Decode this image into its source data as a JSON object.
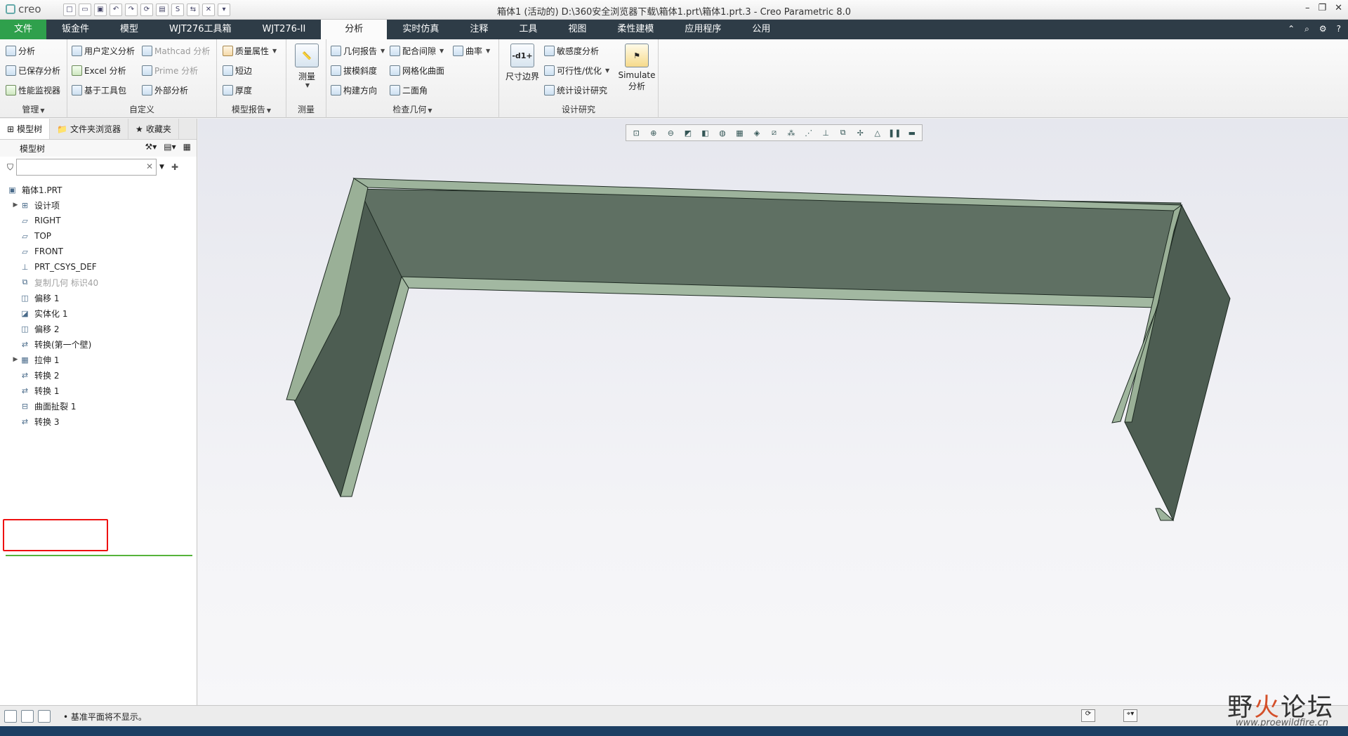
{
  "app": {
    "logo": "creo",
    "window_title": "箱体1 (活动的) D:\\360安全浏览器下载\\箱体1.prt\\箱体1.prt.3 - Creo Parametric 8.0",
    "win_controls": [
      "–",
      "❐",
      "✕"
    ]
  },
  "tabs": [
    "文件",
    "钣金件",
    "模型",
    "WJT276工具箱",
    "WJT276-II",
    "分析",
    "实时仿真",
    "注释",
    "工具",
    "视图",
    "柔性建模",
    "应用程序",
    "公用"
  ],
  "active_tab": "分析",
  "ribbon": {
    "manage": {
      "items": [
        "分析",
        "已保存分析",
        "性能监视器"
      ],
      "label": "管理"
    },
    "custom": {
      "items": [
        "用户定义分析",
        "Mathcad 分析",
        "Excel 分析",
        "Prime 分析",
        "基于工具包",
        "外部分析"
      ],
      "label": "自定义"
    },
    "model_report": {
      "items": [
        "质量属性",
        "短边",
        "厚度"
      ],
      "label": "模型报告"
    },
    "measure": {
      "big": "测量",
      "label": "测量"
    },
    "inspect": {
      "items": [
        "几何报告",
        "配合间隙",
        "曲率",
        "拔模斜度",
        "网格化曲面",
        "构建方向",
        "二面角"
      ],
      "label": "检查几何"
    },
    "design_study": {
      "big_left": "尺寸边界",
      "big_left_icon": "-d1+",
      "items": [
        "敏感度分析",
        "可行性/优化",
        "统计设计研究"
      ],
      "big_right_line1": "Simulate",
      "big_right_line2": "分析",
      "label": "设计研究"
    }
  },
  "panel": {
    "tabs": [
      "模型树",
      "文件夹浏览器",
      "收藏夹"
    ],
    "header": "模型树",
    "filter_value": "",
    "tree": [
      {
        "label": "箱体1.PRT",
        "icon": "part-icon",
        "expander": ""
      },
      {
        "label": "设计项",
        "icon": "design-items-icon",
        "expander": "▶"
      },
      {
        "label": "RIGHT",
        "icon": "datum-plane-icon",
        "expander": ""
      },
      {
        "label": "TOP",
        "icon": "datum-plane-icon",
        "expander": ""
      },
      {
        "label": "FRONT",
        "icon": "datum-plane-icon",
        "expander": ""
      },
      {
        "label": "PRT_CSYS_DEF",
        "icon": "csys-icon",
        "expander": ""
      },
      {
        "label": "复制几何 标识40",
        "icon": "copy-geometry-icon",
        "expander": "",
        "disabled": true
      },
      {
        "label": "偏移 1",
        "icon": "offset-icon",
        "expander": ""
      },
      {
        "label": "实体化 1",
        "icon": "solidify-icon",
        "expander": ""
      },
      {
        "label": "偏移 2",
        "icon": "offset-icon",
        "expander": ""
      },
      {
        "label": "转换(第一个壁)",
        "icon": "convert-icon",
        "expander": ""
      },
      {
        "label": "拉伸 1",
        "icon": "extrude-icon",
        "expander": "▶"
      },
      {
        "label": "转换 2",
        "icon": "convert-icon",
        "expander": ""
      },
      {
        "label": "转换 1",
        "icon": "convert-icon",
        "expander": ""
      },
      {
        "label": "曲面扯裂 1",
        "icon": "surface-rip-icon",
        "expander": ""
      },
      {
        "label": "转换 3",
        "icon": "convert-icon",
        "expander": ""
      }
    ]
  },
  "status": {
    "message": "• 基准平面将不显示。"
  },
  "watermark": {
    "text_a": "野",
    "text_b": "火",
    "text_c": "论坛",
    "url": "www.proewildfire.cn"
  },
  "colors": {
    "tab_bar": "#2e3c47",
    "file_tab": "#2fa04c",
    "model_face": "#5c6f61",
    "model_edge": "#9eb59e"
  }
}
